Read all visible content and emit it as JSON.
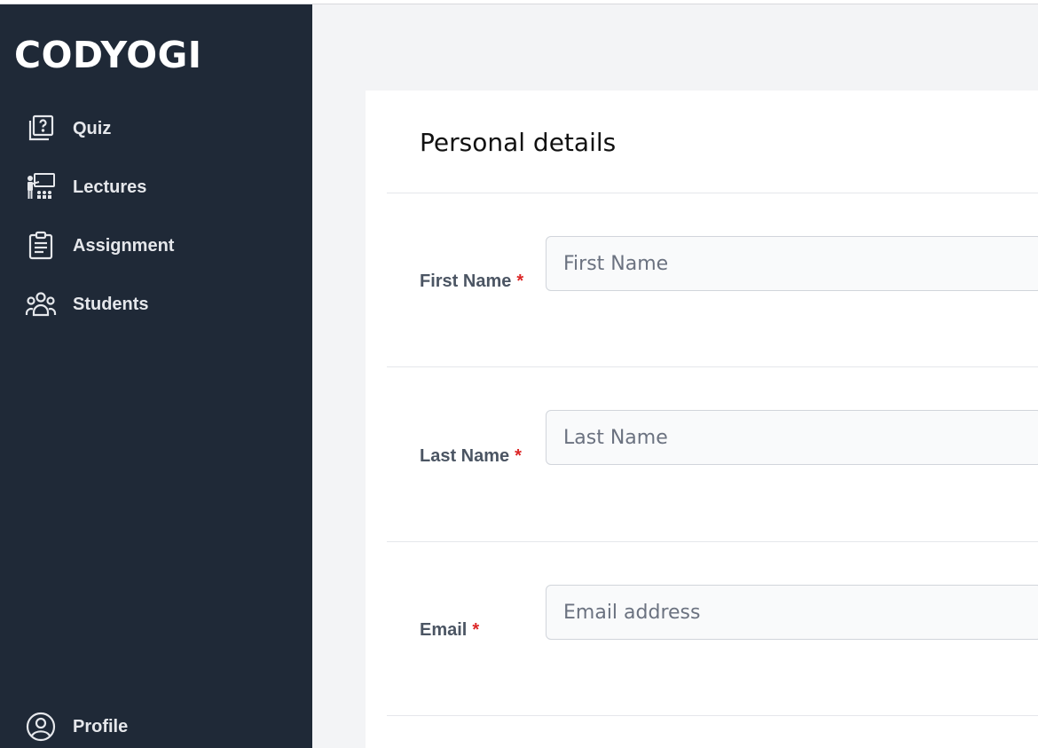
{
  "brand": {
    "name": "CODYOGI"
  },
  "sidebar": {
    "items": [
      {
        "label": "Quiz",
        "icon": "quiz-icon"
      },
      {
        "label": "Lectures",
        "icon": "lectures-icon"
      },
      {
        "label": "Assignment",
        "icon": "assignment-icon"
      },
      {
        "label": "Students",
        "icon": "students-icon"
      }
    ],
    "profile": {
      "label": "Profile",
      "icon": "profile-icon"
    }
  },
  "form": {
    "title": "Personal details",
    "required_mark": "*",
    "fields": [
      {
        "label": "First Name",
        "placeholder": "First Name",
        "value": ""
      },
      {
        "label": "Last Name",
        "placeholder": "Last Name",
        "value": ""
      },
      {
        "label": "Email",
        "placeholder": "Email address",
        "value": ""
      }
    ]
  },
  "colors": {
    "sidebar_bg": "#1f2937",
    "page_bg": "#f3f4f6",
    "card_bg": "#ffffff",
    "required": "#dc2626"
  }
}
